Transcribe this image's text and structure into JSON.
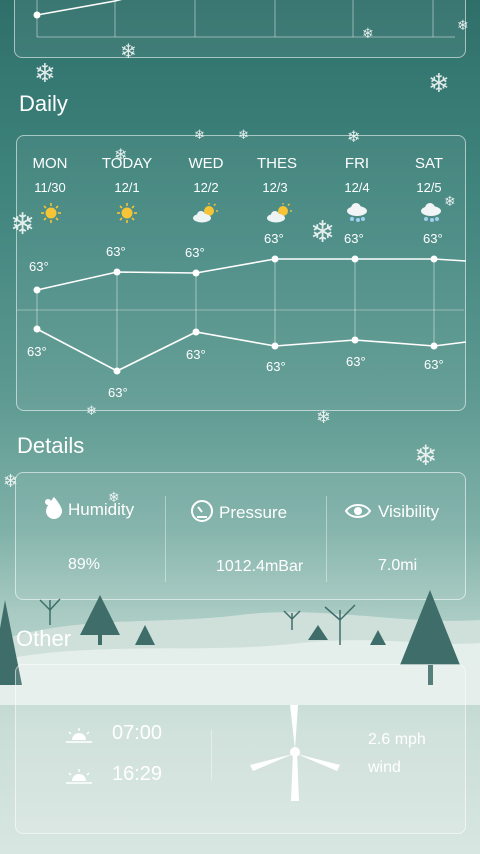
{
  "sections": {
    "daily": "Daily",
    "details": "Details",
    "other": "Other"
  },
  "daily": {
    "days": [
      {
        "name": "MON",
        "date": "11/30",
        "icon": "sun-icon",
        "high": "63°",
        "low": "63°"
      },
      {
        "name": "TODAY",
        "date": "12/1",
        "icon": "sun-icon",
        "high": "63°",
        "low": "63°"
      },
      {
        "name": "WED",
        "date": "12/2",
        "icon": "partly-cloudy-icon",
        "high": "63°",
        "low": "63°"
      },
      {
        "name": "THES",
        "date": "12/3",
        "icon": "partly-cloudy-icon",
        "high": "63°",
        "low": "63°"
      },
      {
        "name": "FRI",
        "date": "12/4",
        "icon": "snow-cloud-icon",
        "high": "63°",
        "low": "63°"
      },
      {
        "name": "SAT",
        "date": "12/5",
        "icon": "snow-cloud-icon",
        "high": "63°",
        "low": "63°"
      }
    ]
  },
  "details": {
    "humidity": {
      "label": "Humidity",
      "value": "89%",
      "icon": "droplet-icon"
    },
    "pressure": {
      "label": "Pressure",
      "value": "1012.4mBar",
      "icon": "gauge-icon"
    },
    "visibility": {
      "label": "Visibility",
      "value": "7.0mi",
      "icon": "eye-icon"
    }
  },
  "other": {
    "sunrise": "07:00",
    "sunset": "16:29",
    "wind_speed": "2.6 mph",
    "wind_label": "wind"
  },
  "colors": {
    "sun": "#f6c437",
    "snow_blue": "#9fd0f0"
  }
}
